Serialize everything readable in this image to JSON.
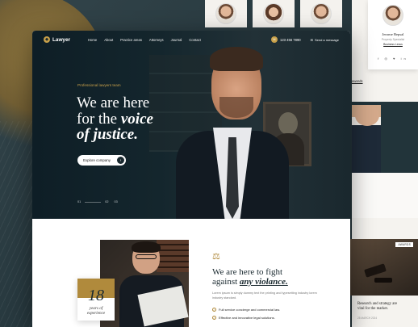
{
  "brand": {
    "name": "Lawyer",
    "logo_icon": "helmet-icon",
    "accent": "#c9a14a",
    "dark": "#14262d"
  },
  "nav": {
    "items": [
      "Home",
      "About",
      "Practice areas",
      "Attorneys",
      "Journal",
      "Contact"
    ],
    "phone": "123 456 7890",
    "message": "Send a message"
  },
  "hero": {
    "eyebrow": "Professional lawyers team",
    "line1": "We are here",
    "line2_plain": "for the ",
    "line2_em": "voice",
    "line3_em": "of justice.",
    "cta_label": "Explore company",
    "slider": {
      "current": "01",
      "next": "02",
      "last": "03"
    }
  },
  "about": {
    "badge_number": "18",
    "badge_line1": "years of",
    "badge_line2": "experience",
    "heading_line1": "We are here to fight",
    "heading_line2_plain": "against ",
    "heading_line2_em": "any violance.",
    "paragraph": "Lorem ipsum is simply dummy text the printing and typesetting industry lorem industry standard.",
    "checks": [
      "Full service concierge and commercial law.",
      "Effective and innovative legal solutions."
    ]
  },
  "side": {
    "profile_name": "Jerome Bepsal",
    "profile_role": "Property Specialist",
    "profile_company": "Business Lexus",
    "social": "f ◎ ♥ in",
    "link_text": "awards",
    "tag": "AWARDS",
    "caption_line1": "Research and strategy are",
    "caption_line2": "vital for the market.",
    "meta": "25 MARCH 2024"
  }
}
